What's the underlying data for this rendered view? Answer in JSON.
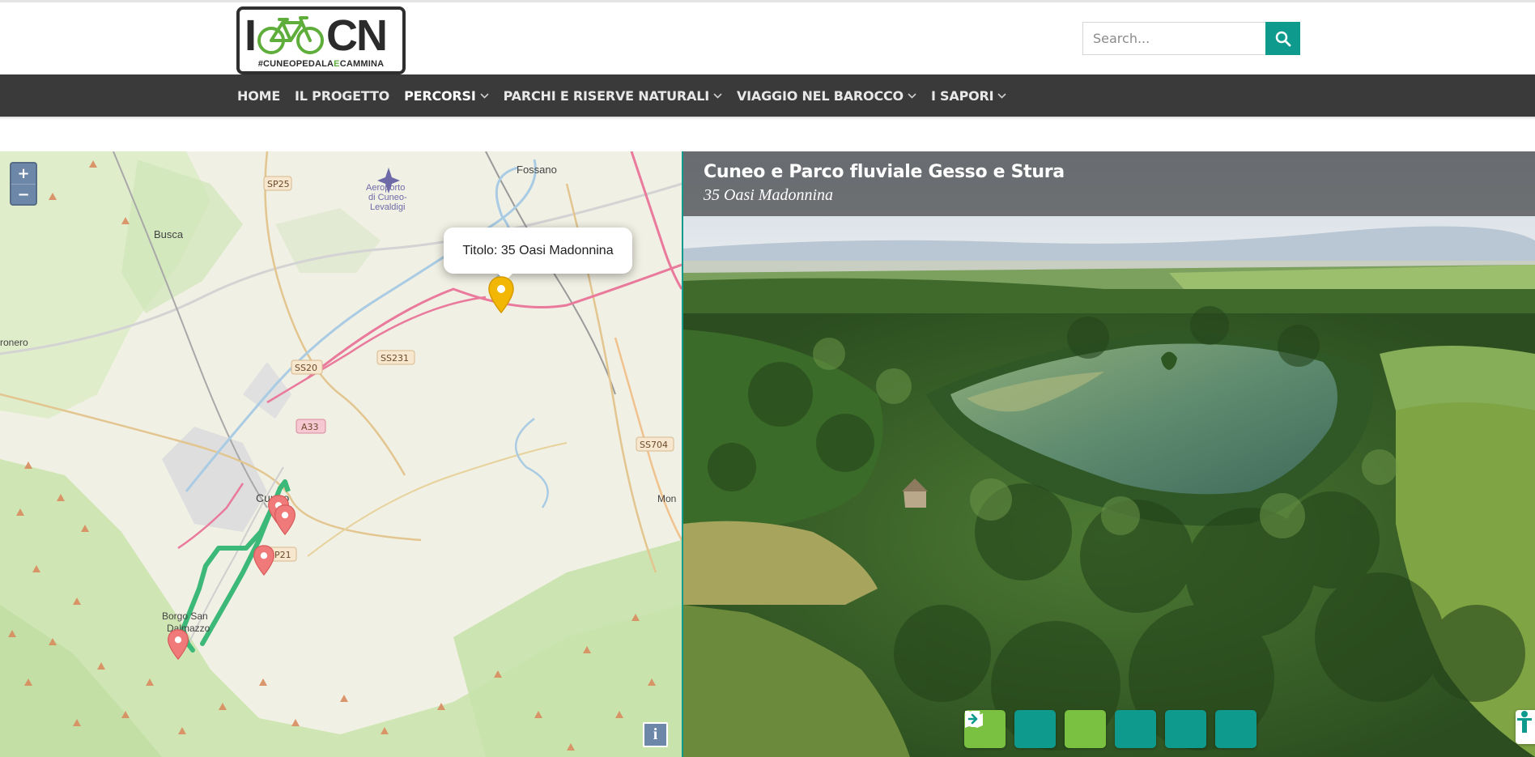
{
  "brand": {
    "logo_word_left": "I",
    "logo_word_right": "CN",
    "logo_tag_a": "#CUNEOPEDALA",
    "logo_tag_b": "E",
    "logo_tag_c": "CAMMINA",
    "colors": {
      "logo_green": "#5fae3c",
      "logo_dark": "#2b2b2b"
    }
  },
  "search": {
    "placeholder": "Search...",
    "value": "",
    "icon": "search-icon",
    "button_color": "#0e9b8e"
  },
  "nav": {
    "background": "#3a3a3a",
    "items": [
      {
        "label": "HOME",
        "dropdown": false,
        "active": false
      },
      {
        "label": "IL PROGETTO",
        "dropdown": false,
        "active": false
      },
      {
        "label": "PERCORSI",
        "dropdown": true,
        "active": true
      },
      {
        "label": "PARCHI E RISERVE NATURALI",
        "dropdown": true,
        "active": false
      },
      {
        "label": "VIAGGIO NEL BAROCCO",
        "dropdown": true,
        "active": false
      },
      {
        "label": "I SAPORI",
        "dropdown": true,
        "active": false
      }
    ]
  },
  "map": {
    "zoom_in": "+",
    "zoom_out": "−",
    "popup_text": "Titolo: 35 Oasi Madonnina",
    "info_label": "i",
    "route_color": "#3cb878",
    "selected_pin_color": "#f2b705",
    "pin_color": "#f07a7a",
    "labels": {
      "fossano": "Fossano",
      "airport_1": "Aeroporto",
      "airport_2": "di Cuneo-",
      "airport_3": "Levaldigi",
      "busca": "Busca",
      "dronero": "ronero",
      "cuneo": "Cuneo",
      "borgo_1": "Borgo San",
      "borgo_2": "Dalmazzo",
      "mon": "Mon",
      "sp25": "SP25",
      "ss20": "SS20",
      "ss231": "SS231",
      "a33": "A33",
      "ss704": "SS704",
      "sp21": "SP21"
    }
  },
  "panorama": {
    "title": "Cuneo e Parco fluviale Gesso e Stura",
    "subtitle": "35 Oasi Madonnina",
    "controls": [
      {
        "icon": "refresh-icon",
        "color": "#7ac142"
      },
      {
        "icon": "navigation-arrow-icon",
        "color": "#0e9b8e"
      },
      {
        "icon": "map-marker-icon",
        "color": "#7ac142"
      },
      {
        "icon": "fullscreen-icon",
        "color": "#0e9b8e"
      },
      {
        "icon": "arrow-left-icon",
        "color": "#0e9b8e"
      },
      {
        "icon": "arrow-right-icon",
        "color": "#0e9b8e"
      }
    ],
    "accessibility_icon": "accessibility-icon"
  }
}
